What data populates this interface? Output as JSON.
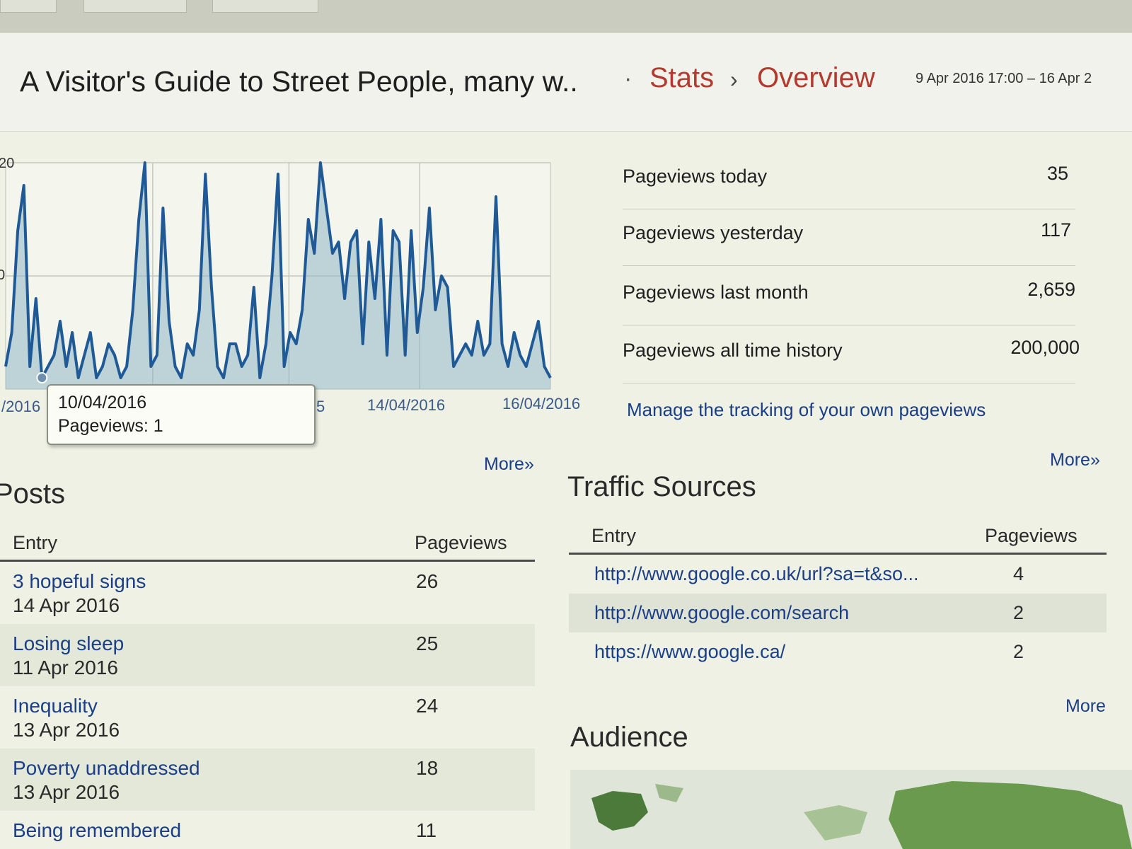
{
  "header": {
    "blog_title": "A Visitor's Guide to Street People, many w..",
    "separator": "·",
    "crumb_stats": "Stats",
    "crumb_arrow": "›",
    "crumb_overview": "Overview",
    "date_range": "9 Apr 2016 17:00 – 16 Apr 2"
  },
  "chart": {
    "y_tick_top": "20",
    "y_tick_mid": "0",
    "x_tick_1": "/2016",
    "x_tick_2": "14/04/2016",
    "x_tick_3": "16/04/2016",
    "x_tick_partial": "5",
    "tooltip_date": "10/04/2016",
    "tooltip_value": "Pageviews: 1",
    "more": "More»",
    "line_color": "#1f5a96",
    "fill_color": "#8fb6c6"
  },
  "chart_data": {
    "type": "area",
    "title": "",
    "xlabel": "",
    "ylabel": "",
    "x_ticks": [
      "/2016",
      "14/04/2016",
      "16/04/2016"
    ],
    "y_ticks": [
      "0",
      "20"
    ],
    "values": [
      2,
      5,
      14,
      18,
      2,
      8,
      1,
      2,
      3,
      6,
      2,
      5,
      1,
      3,
      5,
      1,
      2,
      4,
      3,
      1,
      2,
      7,
      15,
      20,
      2,
      3,
      16,
      6,
      2,
      1,
      4,
      3,
      7,
      19,
      9,
      2,
      1,
      4,
      4,
      2,
      3,
      9,
      1,
      4,
      10,
      19,
      2,
      5,
      4,
      7,
      15,
      12,
      20,
      16,
      12,
      13,
      8,
      13,
      14,
      4,
      13,
      8,
      15,
      3,
      14,
      13,
      3,
      14,
      5,
      9,
      16,
      7,
      10,
      9,
      2,
      3,
      4,
      3,
      6,
      3,
      4,
      17,
      4,
      2,
      5,
      3,
      2,
      4,
      6,
      2,
      1
    ],
    "tooltip": {
      "date": "10/04/2016",
      "value": 1
    }
  },
  "stats": {
    "rows": [
      {
        "label": "Pageviews today",
        "value": "35"
      },
      {
        "label": "Pageviews yesterday",
        "value": "117"
      },
      {
        "label": "Pageviews last month",
        "value": "2,659"
      },
      {
        "label": "Pageviews all time history",
        "value": "200,000"
      }
    ],
    "manage_link": "Manage the tracking of your own pageviews",
    "more": "More»"
  },
  "posts": {
    "title": "Posts",
    "col_entry": "Entry",
    "col_pageviews": "Pageviews",
    "rows": [
      {
        "title": "3 hopeful signs",
        "date": "14 Apr 2016",
        "pageviews": "26"
      },
      {
        "title": "Losing sleep",
        "date": "11 Apr 2016",
        "pageviews": "25"
      },
      {
        "title": "Inequality",
        "date": "13 Apr 2016",
        "pageviews": "24"
      },
      {
        "title": "Poverty unaddressed",
        "date": "13 Apr 2016",
        "pageviews": "18"
      },
      {
        "title": "Being remembered",
        "date": "",
        "pageviews": "11"
      }
    ]
  },
  "traffic": {
    "title": "Traffic Sources",
    "col_entry": "Entry",
    "col_pageviews": "Pageviews",
    "rows": [
      {
        "entry": "http://www.google.co.uk/url?sa=t&so...",
        "pageviews": "4"
      },
      {
        "entry": "http://www.google.com/search",
        "pageviews": "2"
      },
      {
        "entry": "https://www.google.ca/",
        "pageviews": "2"
      }
    ],
    "more": "More"
  },
  "audience": {
    "title": "Audience"
  }
}
